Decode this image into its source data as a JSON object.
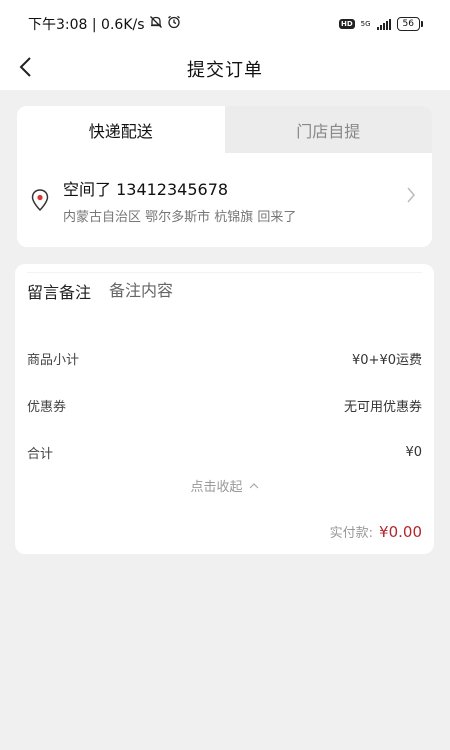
{
  "status_bar": {
    "time_speed": "下午3:08 | 0.6K/s",
    "hd": "HD",
    "network": "5G",
    "battery": "56"
  },
  "nav": {
    "title": "提交订单"
  },
  "delivery": {
    "tabs": [
      {
        "label": "快递配送",
        "active": true
      },
      {
        "label": "门店自提",
        "active": false
      }
    ],
    "address": {
      "name_phone": "空间了 13412345678",
      "detail": "内蒙古自治区 鄂尔多斯市 杭锦旗 回来了"
    }
  },
  "order": {
    "note_label": "留言备注",
    "note_placeholder": "备注内容",
    "rows": [
      {
        "label": "商品小计",
        "value": "¥0+¥0运费"
      },
      {
        "label": "优惠券",
        "value": "无可用优惠券"
      },
      {
        "label": "合计",
        "value": "¥0"
      }
    ],
    "collapse_label": "点击收起",
    "paid_label": "实付款:",
    "paid_amount": "¥0.00",
    "accent_color": "#b3262b"
  }
}
